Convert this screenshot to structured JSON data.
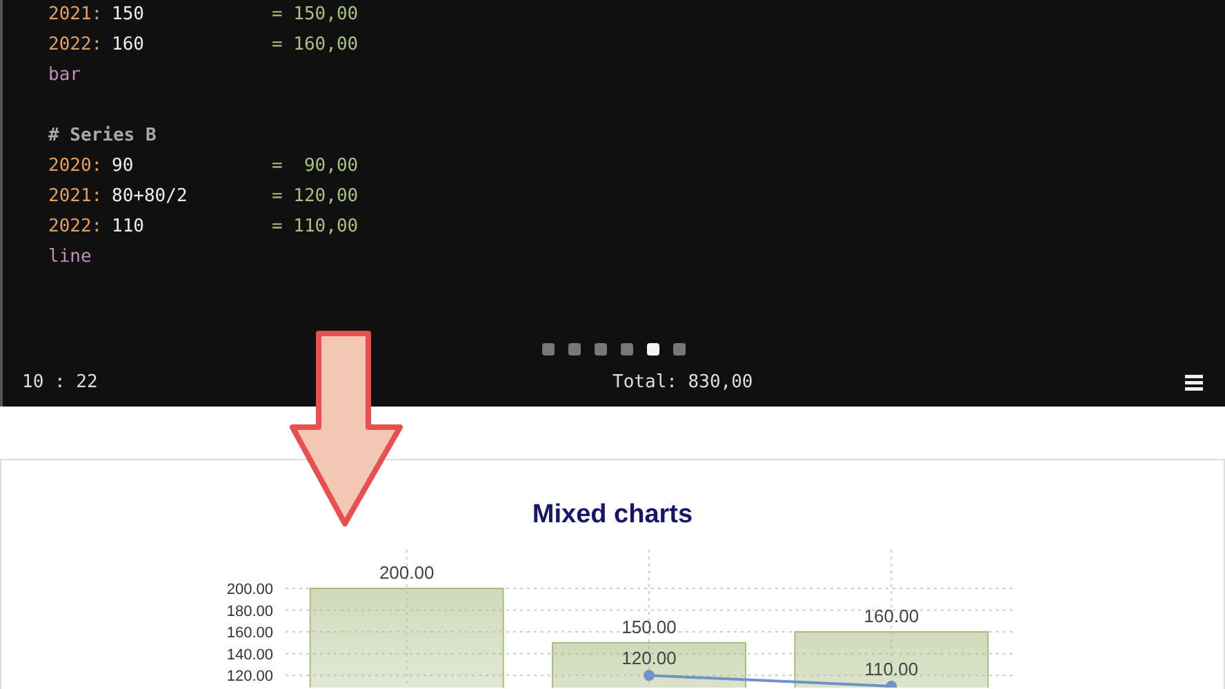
{
  "editor": {
    "lines": [
      {
        "kind": "entry",
        "year": "2021:",
        "expr": "150",
        "result": "= 150,00"
      },
      {
        "kind": "entry",
        "year": "2022:",
        "expr": "160",
        "result": "= 160,00"
      },
      {
        "kind": "keyword",
        "text": "bar"
      },
      {
        "kind": "blank"
      },
      {
        "kind": "comment",
        "text": "# Series B"
      },
      {
        "kind": "entry",
        "year": "2020:",
        "expr": "90",
        "result": "=  90,00"
      },
      {
        "kind": "entry",
        "year": "2021:",
        "expr": "80+80/2",
        "result": "= 120,00"
      },
      {
        "kind": "entry",
        "year": "2022:",
        "expr": "110",
        "result": "= 110,00"
      },
      {
        "kind": "keyword",
        "text": "line"
      }
    ],
    "pages": [
      {
        "selected": false
      },
      {
        "selected": false
      },
      {
        "selected": false
      },
      {
        "selected": false
      },
      {
        "selected": true
      },
      {
        "selected": false
      }
    ],
    "cursor": "10 : 22",
    "total": "Total: 830,00"
  },
  "chart": {
    "title": "Mixed charts",
    "chart_data": {
      "type": "bar",
      "yticks": [
        {
          "value": 120,
          "label": "120.00"
        },
        {
          "value": 140,
          "label": "140.00"
        },
        {
          "value": 160,
          "label": "160.00"
        },
        {
          "value": 180,
          "label": "180.00"
        },
        {
          "value": 200,
          "label": "200.00"
        }
      ],
      "ylim": [
        110,
        200
      ],
      "stacked": false,
      "grid": true,
      "data_labels": true,
      "series": [
        {
          "type": "bar",
          "color": "#a8bc80",
          "values": [
            200,
            150,
            160
          ],
          "value_labels": [
            "200.00",
            "150.00",
            "160.00"
          ]
        },
        {
          "type": "line",
          "color": "#6f93c8",
          "marker": "circle",
          "values": [
            null,
            120,
            110
          ],
          "value_labels": [
            null,
            "120.00",
            "110.00"
          ]
        }
      ]
    }
  }
}
